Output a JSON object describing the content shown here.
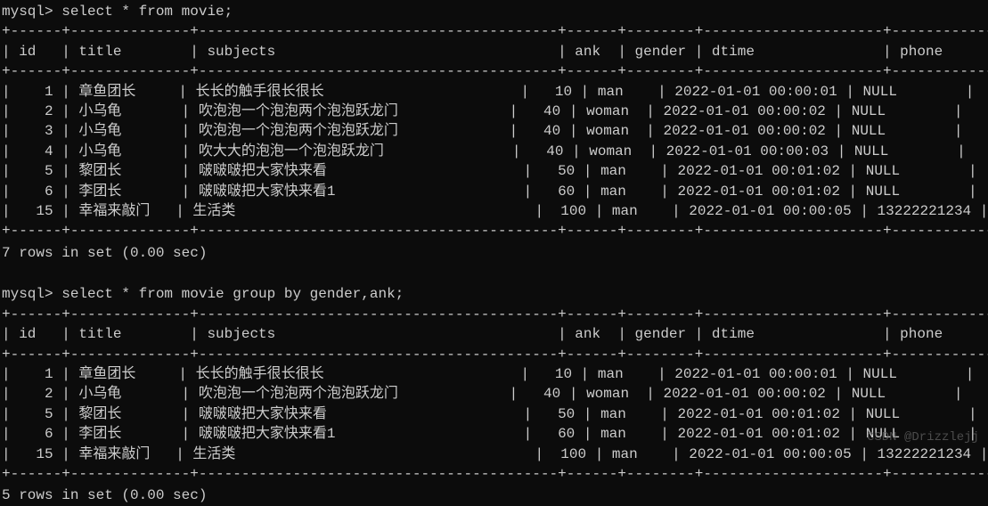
{
  "prompt1": "mysql> select * from movie;",
  "prompt2": "mysql> select * from movie group by gender,ank;",
  "border1": "+------+--------------+------------------------------------------+------+--------+---------------------+-------------+",
  "header_row": "| id   | title        | subjects                                 | ank  | gender | dtime               | phone       |",
  "table1_rows": [
    "|    1 | 章鱼团长     | 长长的触手很长很长                       |   10 | man    | 2022-01-01 00:00:01 | NULL        |",
    "|    2 | 小乌龟       | 吹泡泡一个泡泡两个泡泡跃龙门             |   40 | woman  | 2022-01-01 00:00:02 | NULL        |",
    "|    3 | 小乌龟       | 吹泡泡一个泡泡两个泡泡跃龙门             |   40 | woman  | 2022-01-01 00:00:02 | NULL        |",
    "|    4 | 小乌龟       | 吹大大的泡泡一个泡泡跃龙门               |   40 | woman  | 2022-01-01 00:00:03 | NULL        |",
    "|    5 | 黎团长       | 啵啵啵把大家快来看                       |   50 | man    | 2022-01-01 00:01:02 | NULL        |",
    "|    6 | 李团长       | 啵啵啵把大家快来看1                      |   60 | man    | 2022-01-01 00:01:02 | NULL        |",
    "|   15 | 幸福来敲门   | 生活类                                   |  100 | man    | 2022-01-01 00:00:05 | 13222221234 |"
  ],
  "status1": "7 rows in set (0.00 sec)",
  "table2_rows": [
    "|    1 | 章鱼团长     | 长长的触手很长很长                       |   10 | man    | 2022-01-01 00:00:01 | NULL        |",
    "|    2 | 小乌龟       | 吹泡泡一个泡泡两个泡泡跃龙门             |   40 | woman  | 2022-01-01 00:00:02 | NULL        |",
    "|    5 | 黎团长       | 啵啵啵把大家快来看                       |   50 | man    | 2022-01-01 00:01:02 | NULL        |",
    "|    6 | 李团长       | 啵啵啵把大家快来看1                      |   60 | man    | 2022-01-01 00:01:02 | NULL        |",
    "|   15 | 幸福来敲门   | 生活类                                   |  100 | man    | 2022-01-01 00:00:05 | 13222221234 |"
  ],
  "status2": "5 rows in set (0.00 sec)",
  "watermark": "CSDN @Drizzlejj",
  "watermark2": ""
}
